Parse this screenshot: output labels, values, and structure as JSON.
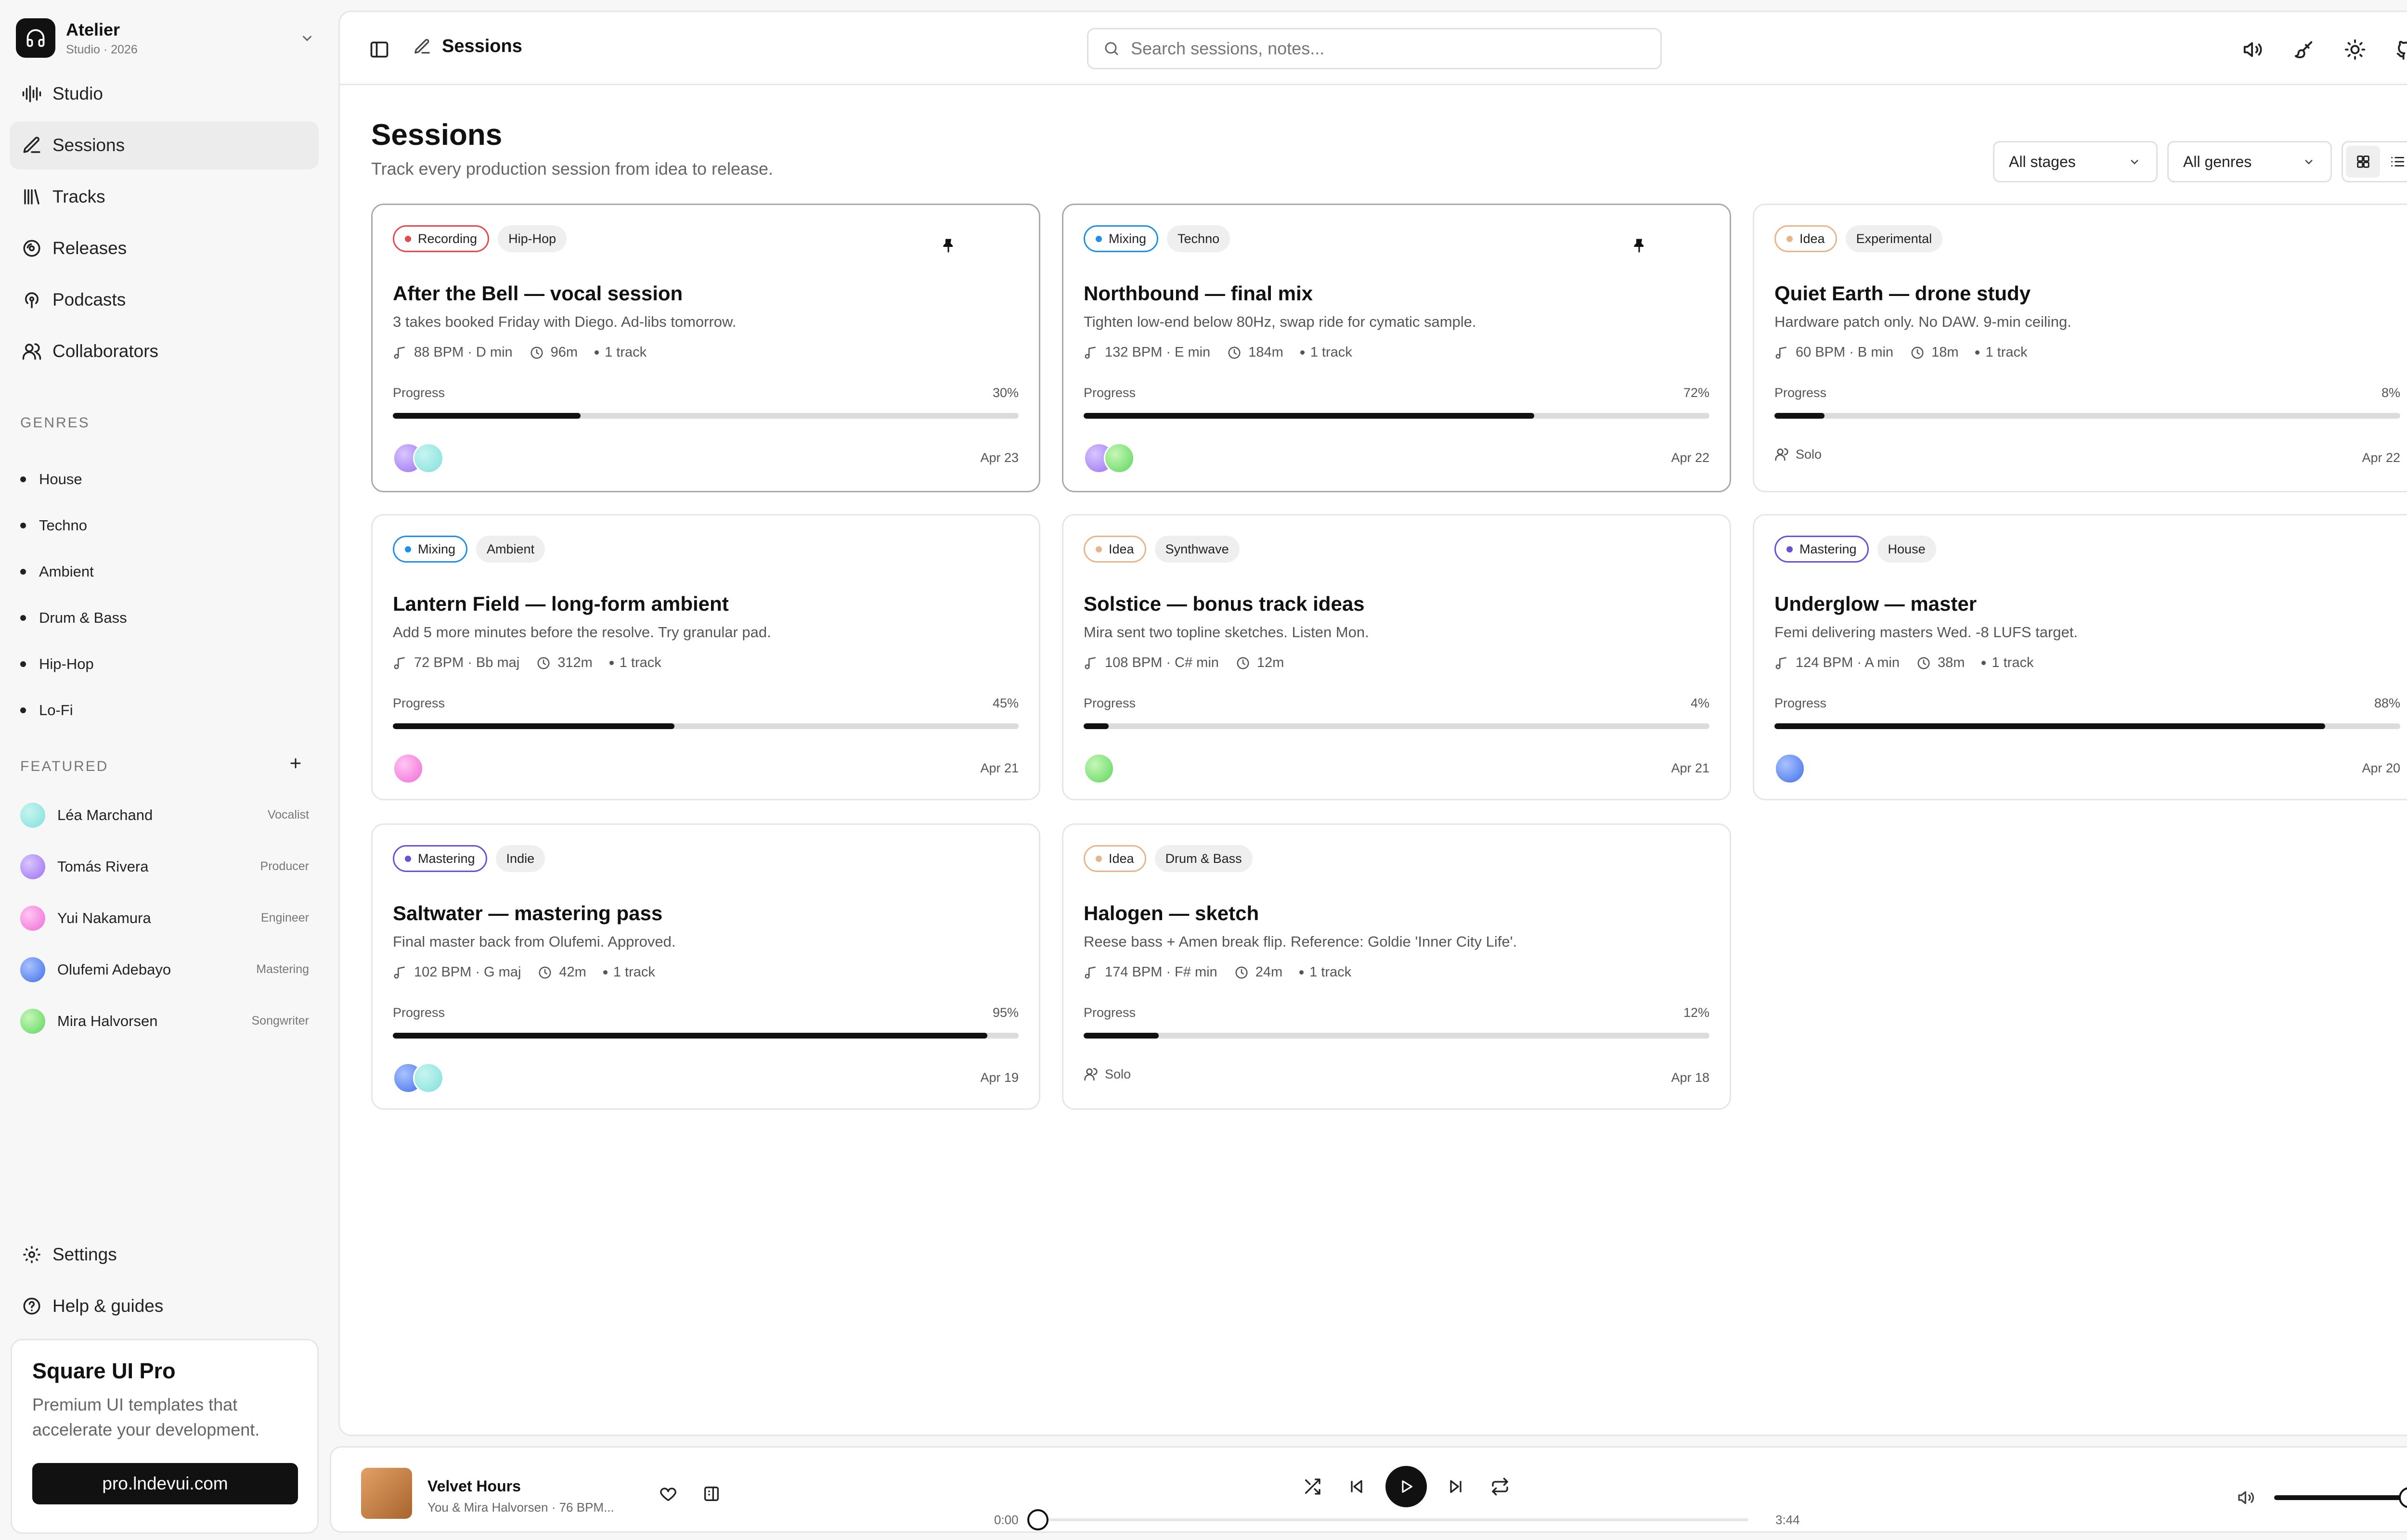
{
  "workspace": {
    "name": "Atelier",
    "subtitle": "Studio · 2026"
  },
  "nav": [
    {
      "label": "Studio",
      "icon": "waveform-icon"
    },
    {
      "label": "Sessions",
      "icon": "pen-icon",
      "active": true
    },
    {
      "label": "Tracks",
      "icon": "library-icon"
    },
    {
      "label": "Releases",
      "icon": "disc-icon"
    },
    {
      "label": "Podcasts",
      "icon": "podcast-icon"
    },
    {
      "label": "Collaborators",
      "icon": "users-icon"
    }
  ],
  "genres_label": "GENRES",
  "genres": [
    "House",
    "Techno",
    "Ambient",
    "Drum & Bass",
    "Hip-Hop",
    "Lo-Fi"
  ],
  "featured_label": "FEATURED",
  "featured": [
    {
      "name": "Léa Marchand",
      "role": "Vocalist",
      "color": "#7fe0dc"
    },
    {
      "name": "Tomás Rivera",
      "role": "Producer",
      "color": "#9b6ff0"
    },
    {
      "name": "Yui Nakamura",
      "role": "Engineer",
      "color": "#f06ad8"
    },
    {
      "name": "Olufemi Adebayo",
      "role": "Mastering",
      "color": "#3f6fe8"
    },
    {
      "name": "Mira Halvorsen",
      "role": "Songwriter",
      "color": "#5cd65c"
    }
  ],
  "bottom_nav": [
    {
      "label": "Settings",
      "icon": "gear-icon"
    },
    {
      "label": "Help & guides",
      "icon": "help-icon"
    }
  ],
  "promo": {
    "title": "Square UI Pro",
    "text": "Premium UI templates that accelerate your development.",
    "button": "pro.lndevui.com"
  },
  "topbar": {
    "breadcrumb": "Sessions",
    "search_placeholder": "Search sessions, notes..."
  },
  "page": {
    "title": "Sessions",
    "subtitle": "Track every production session from idea to release."
  },
  "filters": {
    "stage": "All stages",
    "genre": "All genres",
    "view": "grid"
  },
  "cards": [
    {
      "stage": "Recording",
      "stage_color": "#e5484d",
      "genre": "Hip-Hop",
      "pinned": true,
      "title": "After the Bell — vocal session",
      "desc": "3 takes booked Friday with Diego. Ad-libs tomorrow.",
      "bpm": "88 BPM · D min",
      "time": "96m",
      "tracks": "1 track",
      "progress_label": "Progress",
      "progress": 30,
      "progress_text": "30%",
      "avatars": [
        "#9b6ff0",
        "#7fe0dc"
      ],
      "date": "Apr 23"
    },
    {
      "stage": "Mixing",
      "stage_color": "#1e90e8",
      "genre": "Techno",
      "pinned": true,
      "title": "Northbound — final mix",
      "desc": "Tighten low-end below 80Hz, swap ride for cymatic sample.",
      "bpm": "132 BPM · E min",
      "time": "184m",
      "tracks": "1 track",
      "progress_label": "Progress",
      "progress": 72,
      "progress_text": "72%",
      "avatars": [
        "#9b6ff0",
        "#5cd65c"
      ],
      "date": "Apr 22"
    },
    {
      "stage": "Idea",
      "stage_color": "#e8b48a",
      "genre": "Experimental",
      "pinned": false,
      "title": "Quiet Earth — drone study",
      "desc": "Hardware patch only. No DAW. 9-min ceiling.",
      "bpm": "60 BPM · B min",
      "time": "18m",
      "tracks": "1 track",
      "progress_label": "Progress",
      "progress": 8,
      "progress_text": "8%",
      "solo": "Solo",
      "date": "Apr 22"
    },
    {
      "stage": "Mixing",
      "stage_color": "#1e90e8",
      "genre": "Ambient",
      "pinned": false,
      "title": "Lantern Field — long-form ambient",
      "desc": "Add 5 more minutes before the resolve. Try granular pad.",
      "bpm": "72 BPM · Bb maj",
      "time": "312m",
      "tracks": "1 track",
      "progress_label": "Progress",
      "progress": 45,
      "progress_text": "45%",
      "avatars": [
        "#f06ad8"
      ],
      "date": "Apr 21"
    },
    {
      "stage": "Idea",
      "stage_color": "#e8b48a",
      "genre": "Synthwave",
      "pinned": false,
      "title": "Solstice — bonus track ideas",
      "desc": "Mira sent two topline sketches. Listen Mon.",
      "bpm": "108 BPM · C# min",
      "time": "12m",
      "tracks": "",
      "progress_label": "Progress",
      "progress": 4,
      "progress_text": "4%",
      "avatars": [
        "#5cd65c"
      ],
      "date": "Apr 21"
    },
    {
      "stage": "Mastering",
      "stage_color": "#6b4fd8",
      "genre": "House",
      "pinned": false,
      "title": "Underglow — master",
      "desc": "Femi delivering masters Wed. -8 LUFS target.",
      "bpm": "124 BPM · A min",
      "time": "38m",
      "tracks": "1 track",
      "progress_label": "Progress",
      "progress": 88,
      "progress_text": "88%",
      "avatars": [
        "#3f6fe8"
      ],
      "date": "Apr 20"
    },
    {
      "stage": "Mastering",
      "stage_color": "#6b4fd8",
      "genre": "Indie",
      "pinned": false,
      "title": "Saltwater — mastering pass",
      "desc": "Final master back from Olufemi. Approved.",
      "bpm": "102 BPM · G maj",
      "time": "42m",
      "tracks": "1 track",
      "progress_label": "Progress",
      "progress": 95,
      "progress_text": "95%",
      "avatars": [
        "#3f6fe8",
        "#7fe0dc"
      ],
      "date": "Apr 19"
    },
    {
      "stage": "Idea",
      "stage_color": "#e8b48a",
      "genre": "Drum & Bass",
      "pinned": false,
      "title": "Halogen — sketch",
      "desc": "Reese bass + Amen break flip. Reference: Goldie 'Inner City Life'.",
      "bpm": "174 BPM · F# min",
      "time": "24m",
      "tracks": "1 track",
      "progress_label": "Progress",
      "progress": 12,
      "progress_text": "12%",
      "solo": "Solo",
      "date": "Apr 18"
    }
  ],
  "player": {
    "title": "Velvet Hours",
    "artist": "You & Mira Halvorsen · 76 BPM...",
    "elapsed": "0:00",
    "duration": "3:44",
    "position": 0,
    "volume": 0.85
  }
}
